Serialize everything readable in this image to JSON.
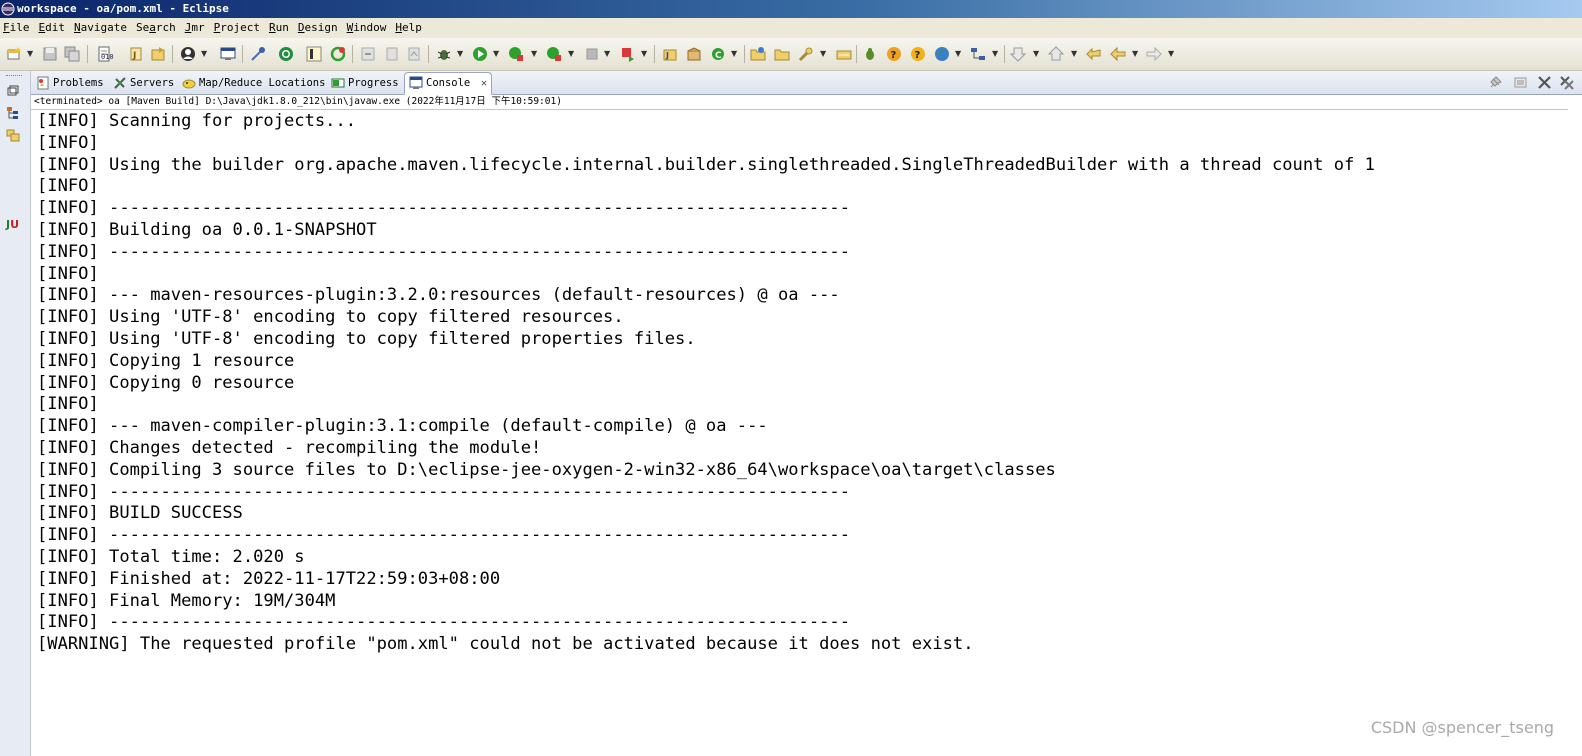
{
  "window": {
    "title": "workspace - oa/pom.xml - Eclipse"
  },
  "menubar": {
    "items": [
      {
        "label": "File",
        "mnemonic": "F"
      },
      {
        "label": "Edit",
        "mnemonic": "E"
      },
      {
        "label": "Navigate",
        "mnemonic": "N"
      },
      {
        "label": "Search",
        "mnemonic": "a"
      },
      {
        "label": "Jmr",
        "mnemonic": "J"
      },
      {
        "label": "Project",
        "mnemonic": "P"
      },
      {
        "label": "Run",
        "mnemonic": "R"
      },
      {
        "label": "Design",
        "mnemonic": "D"
      },
      {
        "label": "Window",
        "mnemonic": "W"
      },
      {
        "label": "Help",
        "mnemonic": "H"
      }
    ]
  },
  "toolbar": {
    "icons": [
      "new-wizard-icon",
      "save-icon",
      "save-all-icon",
      "print-icon",
      "binary-icon",
      "open-type-icon",
      "open-resource-icon",
      "user-icon",
      "console-icon",
      "toggle-breakpoint-icon",
      "skip-breakpoints-icon",
      "mark-occurrences-icon",
      "refresh-icon",
      "step-icon",
      "step-back-icon",
      "debug-icon",
      "run-icon",
      "coverage-icon",
      "external-tools-icon",
      "stop-icon",
      "terminate-icon",
      "new-java-project-icon",
      "new-package-icon",
      "new-class-icon",
      "open-folder-icon",
      "open-file-icon",
      "search-tool-icon",
      "open-task-icon",
      "bug-icon",
      "help-icon",
      "info-icon",
      "globe-icon",
      "hierarchy-icon",
      "next-annotation-icon",
      "prev-annotation-icon",
      "last-edit-icon",
      "back-icon",
      "forward-icon"
    ],
    "colors": {
      "run": "#2ea02e",
      "stop": "#d83a3a",
      "accent": "#f0a020"
    }
  },
  "views": {
    "tabs": [
      {
        "label": "Problems",
        "icon": "problems-icon",
        "active": false
      },
      {
        "label": "Servers",
        "icon": "servers-icon",
        "active": false
      },
      {
        "label": "Map/Reduce Locations",
        "icon": "map-reduce-icon",
        "active": false
      },
      {
        "label": "Progress",
        "icon": "progress-icon",
        "active": false
      },
      {
        "label": "Console",
        "icon": "console-icon",
        "active": true,
        "close": "✕"
      }
    ]
  },
  "console": {
    "status": "<terminated> oa [Maven Build] D:\\Java\\jdk1.8.0_212\\bin\\javaw.exe (2022年11月17日 下午10:59:01)",
    "lines": [
      "[INFO] Scanning for projects...",
      "[INFO]",
      "[INFO] Using the builder org.apache.maven.lifecycle.internal.builder.singlethreaded.SingleThreadedBuilder with a thread count of 1",
      "[INFO]",
      "[INFO] ------------------------------------------------------------------------",
      "[INFO] Building oa 0.0.1-SNAPSHOT",
      "[INFO] ------------------------------------------------------------------------",
      "[INFO]",
      "[INFO] --- maven-resources-plugin:3.2.0:resources (default-resources) @ oa ---",
      "[INFO] Using 'UTF-8' encoding to copy filtered resources.",
      "[INFO] Using 'UTF-8' encoding to copy filtered properties files.",
      "[INFO] Copying 1 resource",
      "[INFO] Copying 0 resource",
      "[INFO]",
      "[INFO] --- maven-compiler-plugin:3.1:compile (default-compile) @ oa ---",
      "[INFO] Changes detected - recompiling the module!",
      "[INFO] Compiling 3 source files to D:\\eclipse-jee-oxygen-2-win32-x86_64\\workspace\\oa\\target\\classes",
      "[INFO] ------------------------------------------------------------------------",
      "[INFO] BUILD SUCCESS",
      "[INFO] ------------------------------------------------------------------------",
      "[INFO] Total time: 2.020 s",
      "[INFO] Finished at: 2022-11-17T22:59:03+08:00",
      "[INFO] Final Memory: 19M/304M",
      "[INFO] ------------------------------------------------------------------------",
      "[WARNING] The requested profile \"pom.xml\" could not be activated because it does not exist."
    ]
  },
  "watermark": "CSDN @spencer_tseng"
}
